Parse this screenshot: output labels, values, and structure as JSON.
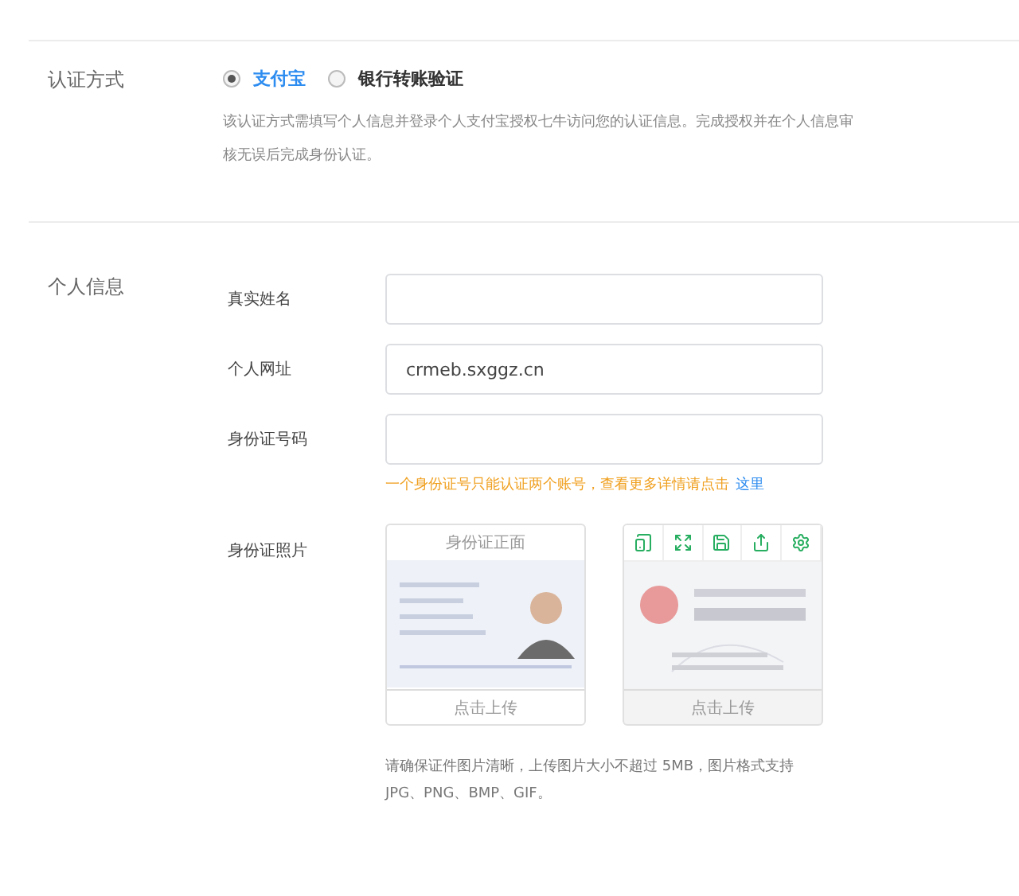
{
  "auth_section": {
    "label": "认证方式",
    "options": [
      {
        "label": "支付宝",
        "selected": true
      },
      {
        "label": "银行转账验证",
        "selected": false
      }
    ],
    "description": "该认证方式需填写个人信息并登录个人支付宝授权七牛访问您的认证信息。完成授权并在个人信息审核无误后完成身份认证。"
  },
  "personal_section": {
    "label": "个人信息",
    "fields": [
      {
        "label": "真实姓名"
      },
      {
        "label": "个人网址",
        "value": "crmeb.sxggz.cn"
      },
      {
        "label": "身份证号码"
      }
    ],
    "id_hint": "一个身份证号只能认证两个账号，查看更多详情请点击",
    "id_hint_link": "这里",
    "photo_label": "身份证照片",
    "photos": [
      {
        "caption": "身份证正面",
        "upload": "点击上传",
        "kind": "front",
        "toolbar": false
      },
      {
        "upload": "点击上传",
        "kind": "back",
        "toolbar": true
      }
    ],
    "photo_note": "请确保证件图片清晰，上传图片大小不超过 5MB，图片格式支持 JPG、PNG、BMP、GIF。"
  }
}
